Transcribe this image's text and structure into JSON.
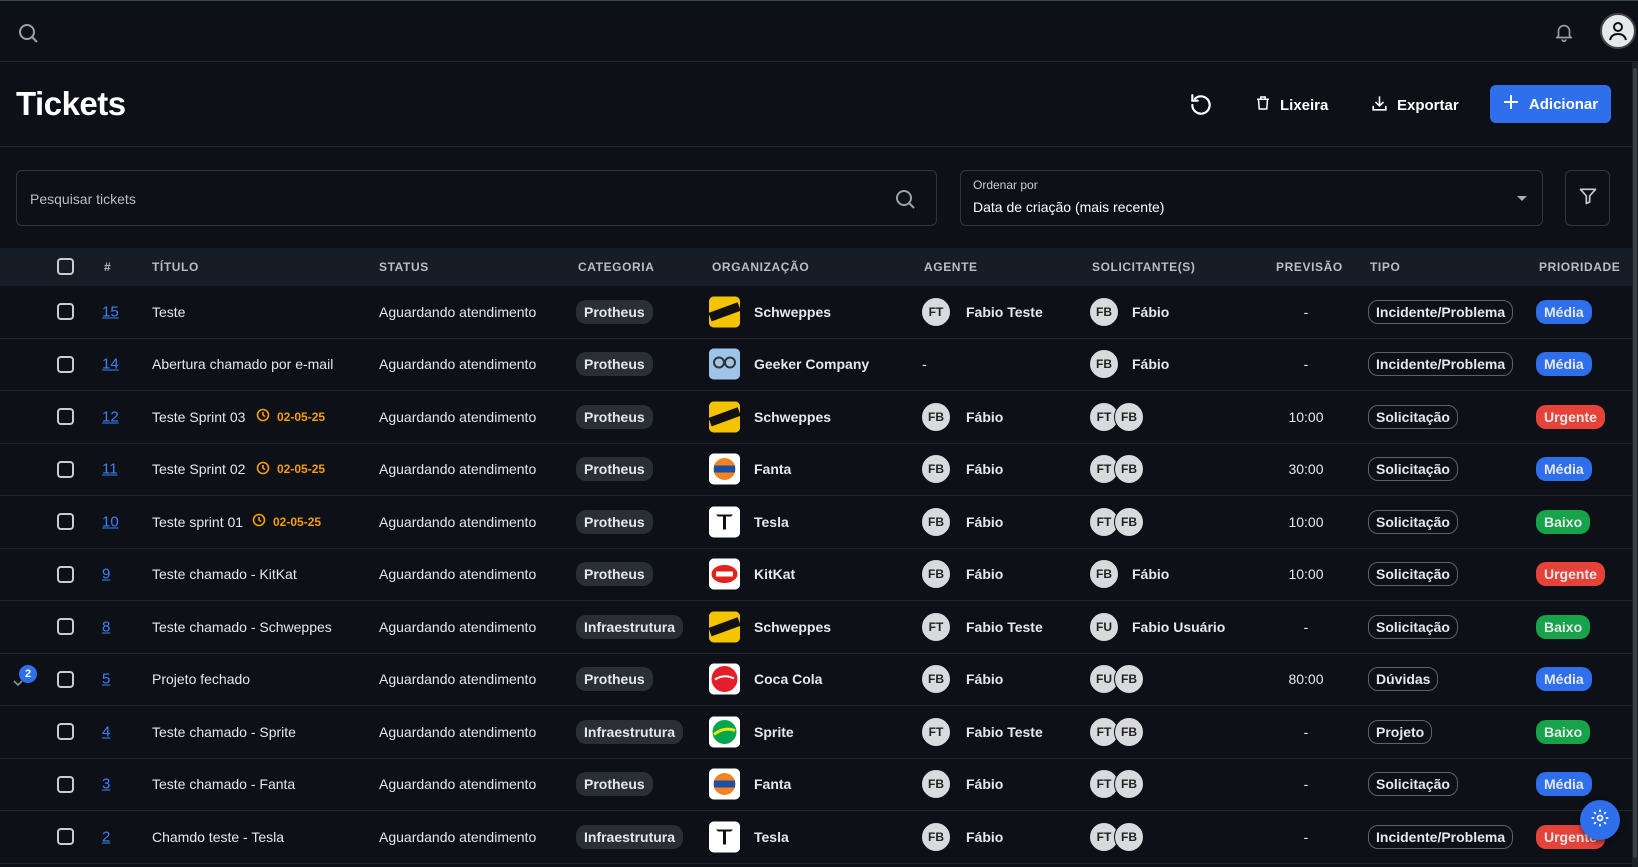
{
  "header": {
    "title": "Tickets",
    "lixeira_label": "Lixeira",
    "exportar_label": "Exportar",
    "adicionar_label": "Adicionar"
  },
  "search": {
    "placeholder": "Pesquisar tickets"
  },
  "order": {
    "label": "Ordenar por",
    "value": "Data de criação (mais recente)"
  },
  "columns": {
    "num": "#",
    "titulo": "TÍTULO",
    "status": "STATUS",
    "categoria": "CATEGORIA",
    "organizacao": "ORGANIZAÇÃO",
    "agente": "AGENTE",
    "solicitante": "SOLICITANTE(S)",
    "previsao": "PREVISÃO",
    "tipo": "TIPO",
    "prioridade": "PRIORIDADE"
  },
  "expand_badge": "2",
  "colors": {
    "accent": "#2f6fec",
    "media": "#2f6fec",
    "urgente": "#e5433a",
    "baixo": "#16a34a",
    "due": "#f59e0b"
  },
  "rows": [
    {
      "num": "15",
      "title": "Teste",
      "due": "",
      "status": "Aguardando atendimento",
      "category": "Protheus",
      "org": "Schweppes",
      "org_logo": "schweppes",
      "agent_initials": "FT",
      "agent": "Fabio Teste",
      "req_initials": [
        "FB"
      ],
      "req_name": "Fábio",
      "previsao": "-",
      "tipo": "Incidente/Problema",
      "prioridade": "Média"
    },
    {
      "num": "14",
      "title": "Abertura chamado por e-mail",
      "due": "",
      "status": "Aguardando atendimento",
      "category": "Protheus",
      "org": "Geeker Company",
      "org_logo": "geeker",
      "agent_initials": "",
      "agent": "-",
      "req_initials": [
        "FB"
      ],
      "req_name": "Fábio",
      "previsao": "-",
      "tipo": "Incidente/Problema",
      "prioridade": "Média"
    },
    {
      "num": "12",
      "title": "Teste Sprint 03",
      "due": "02-05-25",
      "status": "Aguardando atendimento",
      "category": "Protheus",
      "org": "Schweppes",
      "org_logo": "schweppes",
      "agent_initials": "FB",
      "agent": "Fábio",
      "req_initials": [
        "FT",
        "FB"
      ],
      "req_name": "",
      "previsao": "10:00",
      "tipo": "Solicitação",
      "prioridade": "Urgente"
    },
    {
      "num": "11",
      "title": "Teste Sprint 02",
      "due": "02-05-25",
      "status": "Aguardando atendimento",
      "category": "Protheus",
      "org": "Fanta",
      "org_logo": "fanta",
      "agent_initials": "FB",
      "agent": "Fábio",
      "req_initials": [
        "FT",
        "FB"
      ],
      "req_name": "",
      "previsao": "30:00",
      "tipo": "Solicitação",
      "prioridade": "Média"
    },
    {
      "num": "10",
      "title": "Teste sprint 01",
      "due": "02-05-25",
      "status": "Aguardando atendimento",
      "category": "Protheus",
      "org": "Tesla",
      "org_logo": "tesla",
      "agent_initials": "FB",
      "agent": "Fábio",
      "req_initials": [
        "FT",
        "FB"
      ],
      "req_name": "",
      "previsao": "10:00",
      "tipo": "Solicitação",
      "prioridade": "Baixo"
    },
    {
      "num": "9",
      "title": "Teste chamado - KitKat",
      "due": "",
      "status": "Aguardando atendimento",
      "category": "Protheus",
      "org": "KitKat",
      "org_logo": "kitkat",
      "agent_initials": "FB",
      "agent": "Fábio",
      "req_initials": [
        "FB"
      ],
      "req_name": "Fábio",
      "previsao": "10:00",
      "tipo": "Solicitação",
      "prioridade": "Urgente"
    },
    {
      "num": "8",
      "title": "Teste chamado - Schweppes",
      "due": "",
      "status": "Aguardando atendimento",
      "category": "Infraestrutura",
      "org": "Schweppes",
      "org_logo": "schweppes",
      "agent_initials": "FT",
      "agent": "Fabio Teste",
      "req_initials": [
        "FU"
      ],
      "req_name": "Fabio Usuário",
      "previsao": "-",
      "tipo": "Solicitação",
      "prioridade": "Baixo"
    },
    {
      "num": "5",
      "title": "Projeto fechado",
      "due": "",
      "status": "Aguardando atendimento",
      "category": "Protheus",
      "org": "Coca Cola",
      "org_logo": "coca",
      "agent_initials": "FB",
      "agent": "Fábio",
      "req_initials": [
        "FU",
        "FB"
      ],
      "req_name": "",
      "previsao": "80:00",
      "tipo": "Dúvidas",
      "prioridade": "Média"
    },
    {
      "num": "4",
      "title": "Teste chamado - Sprite",
      "due": "",
      "status": "Aguardando atendimento",
      "category": "Infraestrutura",
      "org": "Sprite",
      "org_logo": "sprite",
      "agent_initials": "FT",
      "agent": "Fabio Teste",
      "req_initials": [
        "FT",
        "FB"
      ],
      "req_name": "",
      "previsao": "-",
      "tipo": "Projeto",
      "prioridade": "Baixo"
    },
    {
      "num": "3",
      "title": "Teste chamado - Fanta",
      "due": "",
      "status": "Aguardando atendimento",
      "category": "Protheus",
      "org": "Fanta",
      "org_logo": "fanta",
      "agent_initials": "FB",
      "agent": "Fábio",
      "req_initials": [
        "FT",
        "FB"
      ],
      "req_name": "",
      "previsao": "-",
      "tipo": "Solicitação",
      "prioridade": "Média"
    },
    {
      "num": "2",
      "title": "Chamdo teste - Tesla",
      "due": "",
      "status": "Aguardando atendimento",
      "category": "Infraestrutura",
      "org": "Tesla",
      "org_logo": "tesla",
      "agent_initials": "FB",
      "agent": "Fábio",
      "req_initials": [
        "FT",
        "FB"
      ],
      "req_name": "",
      "previsao": "-",
      "tipo": "Incidente/Problema",
      "prioridade": "Urgente"
    }
  ]
}
